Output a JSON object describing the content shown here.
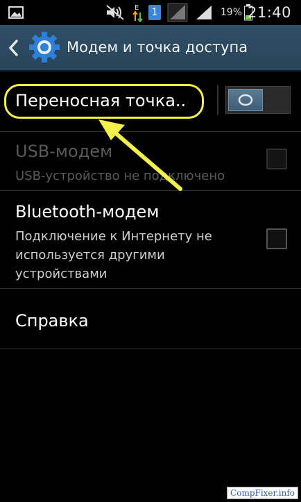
{
  "status_bar": {
    "battery_percent": "19%",
    "time": "21:40",
    "sim_badge": "1",
    "icons": [
      "picture-icon",
      "mute-icon",
      "data-arrows-icon",
      "sim-icon",
      "signal-icon",
      "signal-icon",
      "battery-icon"
    ]
  },
  "action_bar": {
    "title": "Модем и точка доступа"
  },
  "list": {
    "hotspot": {
      "title": "Переносная точка..",
      "toggle_on": false
    },
    "usb": {
      "title": "USB-модем",
      "subtitle": "USB-устройство не подключено",
      "enabled": false,
      "checked": false
    },
    "bluetooth": {
      "title": "Bluetooth-модем",
      "subtitle": "Подключение к Интернету не используется другими устройствами",
      "checked": false
    },
    "help": {
      "title": "Справка"
    }
  },
  "watermark": "CompFixer.info",
  "colors": {
    "action_bar": "#2f4f66",
    "highlight": "#f4f04a",
    "toggle_knob": "#4d6c84"
  }
}
